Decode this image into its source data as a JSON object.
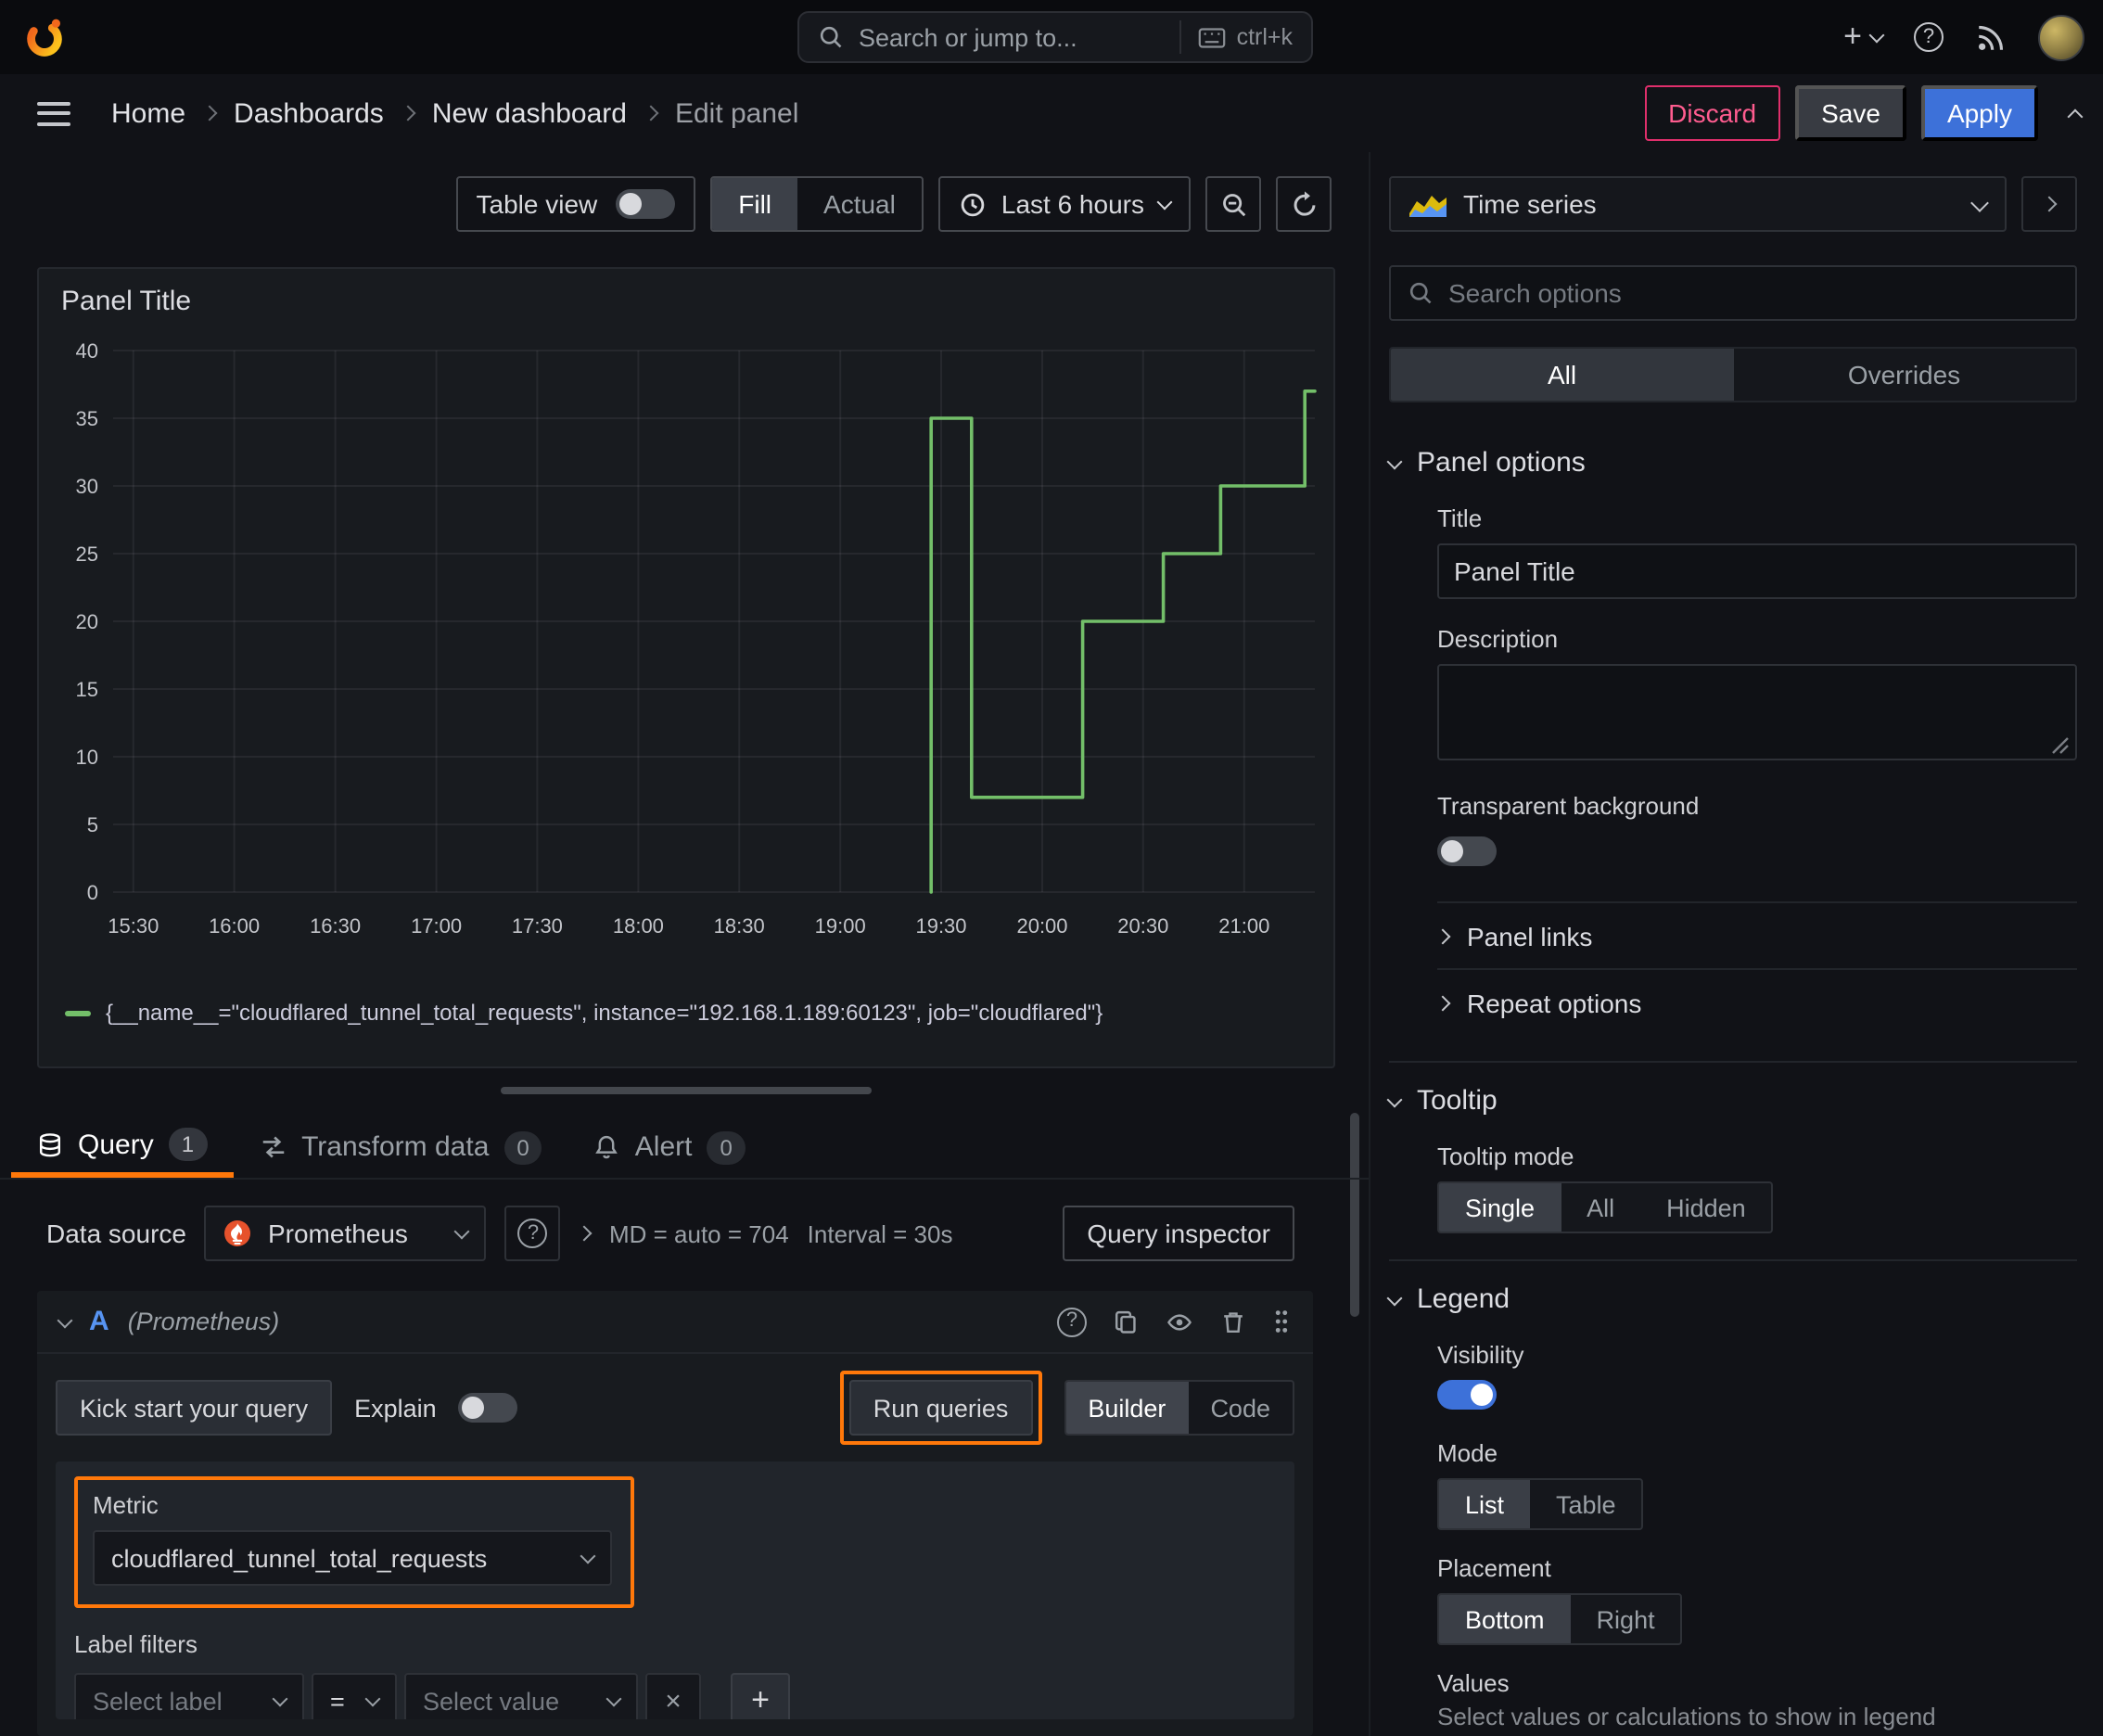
{
  "colors": {
    "accent_orange": "#ff780a",
    "primary_blue": "#3d71d9",
    "series_green": "#73bf69",
    "destructive_red": "#e02f6c"
  },
  "icons": {
    "help": "?",
    "close": "×",
    "add": "+"
  },
  "topnav": {
    "search_placeholder": "Search or jump to...",
    "search_shortcut": "ctrl+k",
    "add_label": "+"
  },
  "breadcrumb": {
    "items": [
      "Home",
      "Dashboards",
      "New dashboard",
      "Edit panel"
    ]
  },
  "actions": {
    "discard": "Discard",
    "save": "Save",
    "apply": "Apply"
  },
  "viz_toolbar": {
    "table_view": "Table view",
    "fill": "Fill",
    "actual": "Actual",
    "time_range": "Last 6 hours"
  },
  "panel": {
    "title": "Panel Title"
  },
  "chart_data": {
    "type": "line",
    "title": "Panel Title",
    "x_ticks": [
      "15:30",
      "16:00",
      "16:30",
      "17:00",
      "17:30",
      "18:00",
      "18:30",
      "19:00",
      "19:30",
      "20:00",
      "20:30",
      "21:00"
    ],
    "x_domain_minutes": [
      924,
      1281
    ],
    "y_ticks": [
      0,
      5,
      10,
      15,
      20,
      25,
      30,
      35,
      40
    ],
    "ylim": [
      0,
      40
    ],
    "grid": true,
    "legend_position": "bottom",
    "series": [
      {
        "name": "{__name__=\"cloudflared_tunnel_total_requests\", instance=\"192.168.1.189:60123\", job=\"cloudflared\"}",
        "color": "#73bf69",
        "points_minutes": [
          [
            1167,
            0
          ],
          [
            1167,
            35
          ],
          [
            1179,
            35
          ],
          [
            1179,
            7
          ],
          [
            1212,
            7
          ],
          [
            1212,
            20
          ],
          [
            1236,
            20
          ],
          [
            1236,
            25
          ],
          [
            1253,
            25
          ],
          [
            1253,
            30
          ],
          [
            1278,
            30
          ],
          [
            1278,
            37
          ],
          [
            1281,
            37
          ]
        ]
      }
    ]
  },
  "tabs": {
    "query_label": "Query",
    "query_count": "1",
    "transform_label": "Transform data",
    "transform_count": "0",
    "alert_label": "Alert",
    "alert_count": "0"
  },
  "query": {
    "datasource_label": "Data source",
    "datasource_value": "Prometheus",
    "max_data_points": "MD = auto = 704",
    "interval": "Interval = 30s",
    "query_inspector": "Query inspector",
    "ref_id": "A",
    "ref_type": "(Prometheus)",
    "kick_start": "Kick start your query",
    "explain": "Explain",
    "run_queries": "Run queries",
    "builder": "Builder",
    "code": "Code",
    "metric_label": "Metric",
    "metric_value": "cloudflared_tunnel_total_requests",
    "label_filters": "Label filters",
    "select_label": "Select label",
    "operator": "=",
    "select_value": "Select value"
  },
  "options_pane": {
    "visualization": "Time series",
    "search_placeholder": "Search options",
    "tab_all": "All",
    "tab_overrides": "Overrides",
    "panel_options": {
      "header": "Panel options",
      "title_label": "Title",
      "title_value": "Panel Title",
      "description_label": "Description",
      "transparent_label": "Transparent background",
      "panel_links": "Panel links",
      "repeat_options": "Repeat options"
    },
    "tooltip": {
      "header": "Tooltip",
      "mode_label": "Tooltip mode",
      "modes": [
        "Single",
        "All",
        "Hidden"
      ]
    },
    "legend": {
      "header": "Legend",
      "visibility_label": "Visibility",
      "mode_label": "Mode",
      "modes": [
        "List",
        "Table"
      ],
      "placement_label": "Placement",
      "placements": [
        "Bottom",
        "Right"
      ],
      "values_label": "Values",
      "values_hint": "Select values or calculations to show in legend"
    }
  }
}
